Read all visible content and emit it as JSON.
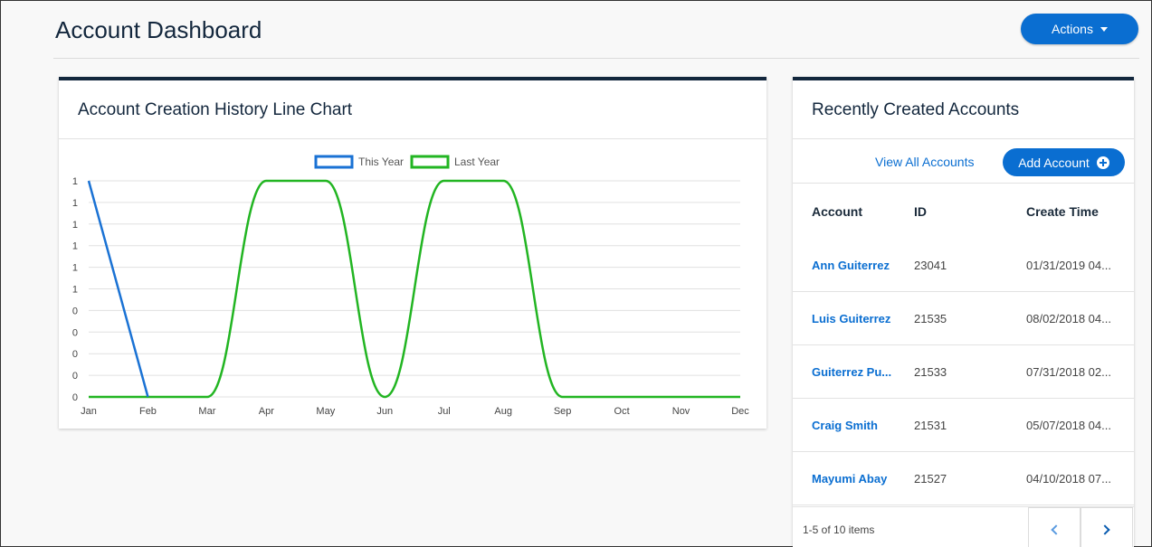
{
  "header": {
    "title": "Account Dashboard",
    "actions_label": "Actions"
  },
  "chart_card": {
    "title": "Account Creation History Line Chart"
  },
  "chart_data": {
    "type": "line",
    "title": "Account Creation History Line Chart",
    "categories": [
      "Jan",
      "Feb",
      "Mar",
      "Apr",
      "May",
      "Jun",
      "Jul",
      "Aug",
      "Sep",
      "Oct",
      "Nov",
      "Dec"
    ],
    "y_tick_labels": [
      "0",
      "0",
      "0",
      "0",
      "0",
      "1",
      "1",
      "1",
      "1",
      "1",
      "1"
    ],
    "ylim": [
      0,
      1
    ],
    "grid": true,
    "legend_position": "top-center",
    "series": [
      {
        "name": "This Year",
        "color": "#1a72d4",
        "values": [
          1,
          0
        ]
      },
      {
        "name": "Last Year",
        "color": "#22b522",
        "values": [
          0,
          0,
          0,
          1,
          1,
          0,
          1,
          1,
          0,
          0,
          0,
          0
        ]
      }
    ]
  },
  "accounts_card": {
    "title": "Recently Created Accounts",
    "view_all_label": "View All Accounts",
    "add_account_label": "Add Account",
    "columns": [
      "Account",
      "ID",
      "Create Time"
    ],
    "rows": [
      {
        "name": "Ann Guiterrez",
        "id": "23041",
        "time": "01/31/2019 04..."
      },
      {
        "name": "Luis Guiterrez",
        "id": "21535",
        "time": "08/02/2018 04..."
      },
      {
        "name": "Guiterrez Pu...",
        "id": "21533",
        "time": "07/31/2018 02..."
      },
      {
        "name": "Craig Smith",
        "id": "21531",
        "time": "05/07/2018 04..."
      },
      {
        "name": "Mayumi Abay",
        "id": "21527",
        "time": "04/10/2018 07..."
      }
    ],
    "pager_info": "1-5 of 10 items"
  }
}
